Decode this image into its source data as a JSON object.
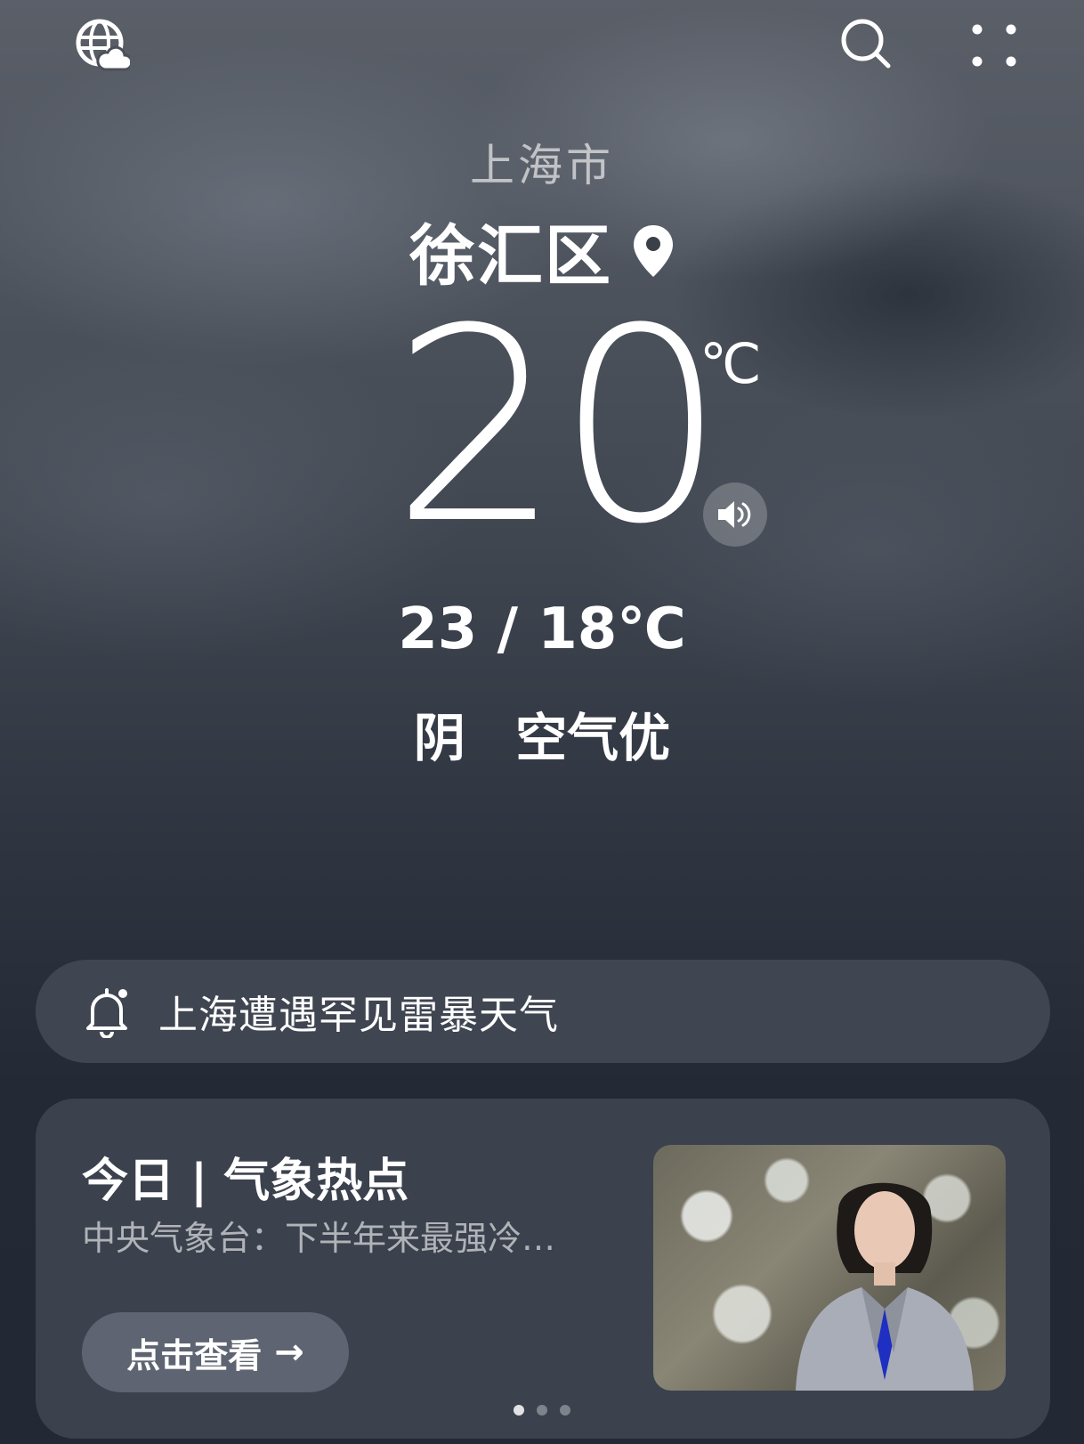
{
  "header": {
    "globe_icon": "globe-weather-icon",
    "search_icon": "search-icon",
    "more_icon": "more-dots-icon"
  },
  "location": {
    "city": "上海市",
    "district": "徐汇区",
    "pin_icon": "location-pin-icon"
  },
  "current": {
    "temperature": "20",
    "unit": "℃",
    "range": "23 / 18℃",
    "condition": "阴",
    "air_quality": "空气优",
    "speaker_icon": "speaker-icon"
  },
  "alert": {
    "icon": "bell-alert-icon",
    "text": "上海遭遇罕见雷暴天气"
  },
  "news_card": {
    "title": "今日 | 气象热点",
    "subtitle": "中央气象台：下半年来最强冷…",
    "cta_label": "点击查看",
    "cta_arrow": "→",
    "thumbnail": "news-anchor-snow-thumbnail"
  },
  "pager": {
    "count": 3,
    "active_index": 0
  }
}
